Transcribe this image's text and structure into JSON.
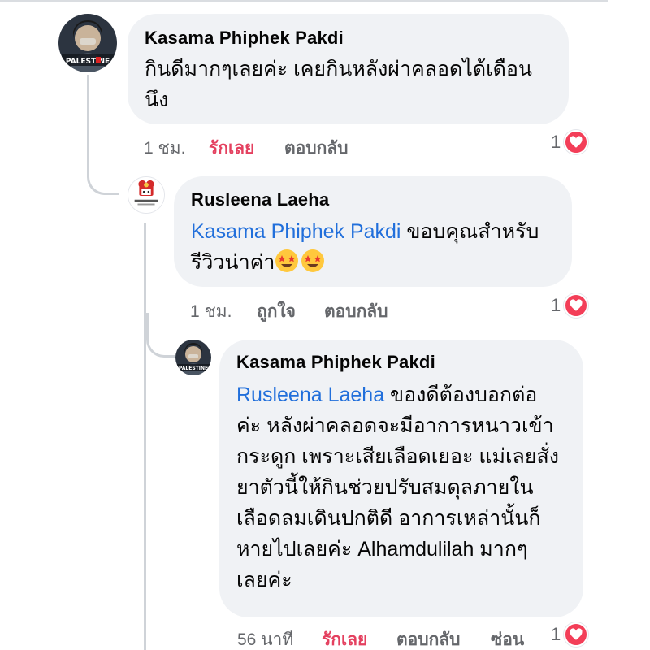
{
  "comments": [
    {
      "author": "Kasama Phiphek Pakdi",
      "avatar_badge": "PALESTINE",
      "text_lines": [
        "กินดีมากๆเลยค่ะ  เคยกินหลังผ่าคลอดได้เดือน",
        "นึง"
      ],
      "time": "1 ชม.",
      "like_label": "รักเลย",
      "reply_label": "ตอบกลับ",
      "reaction_count": "1",
      "reaction_icon": "heart-icon"
    },
    {
      "author": "Rusleena Laeha",
      "mention": "Kasama Phiphek Pakdi",
      "text_line1_rest": " ขอบคุณสำหรับ",
      "text_line2": "รีวิวน่าค่า",
      "emojis": [
        "star-struck-emoji",
        "star-struck-emoji"
      ],
      "time": "1 ชม.",
      "like_label": "ถูกใจ",
      "reply_label": "ตอบกลับ",
      "reaction_count": "1",
      "reaction_icon": "heart-icon"
    },
    {
      "author": "Kasama Phiphek Pakdi",
      "avatar_badge": "PALESTINE",
      "mention": "Rusleena Laeha",
      "text_line1_rest": " ของดีต้องบอกต่อ",
      "text_lines": [
        "ค่ะ หลังผ่าคลอดจะมีอาการหนาวเข้า",
        "กระดูก เพราะเสียเลือดเยอะ แม่เลยสั่ง",
        "ยาตัวนี้ให้กินช่วยปรับสมดุลภายใน",
        "เลือดลมเดินปกติดี อาการเหล่านั้นก็",
        "หายไปเลยค่ะ Alhamdulilah มากๆ",
        "เลยค่ะ"
      ],
      "time": "56 นาที",
      "like_label": "รักเลย",
      "reply_label": "ตอบกลับ",
      "hide_label": "ซ่อน",
      "reaction_count": "1",
      "reaction_icon": "heart-icon"
    }
  ],
  "colors": {
    "bubble": "#f0f2f5",
    "mention": "#216fdb",
    "love": "#e4405f",
    "heart": "#f33e58",
    "meta": "#65676b"
  }
}
